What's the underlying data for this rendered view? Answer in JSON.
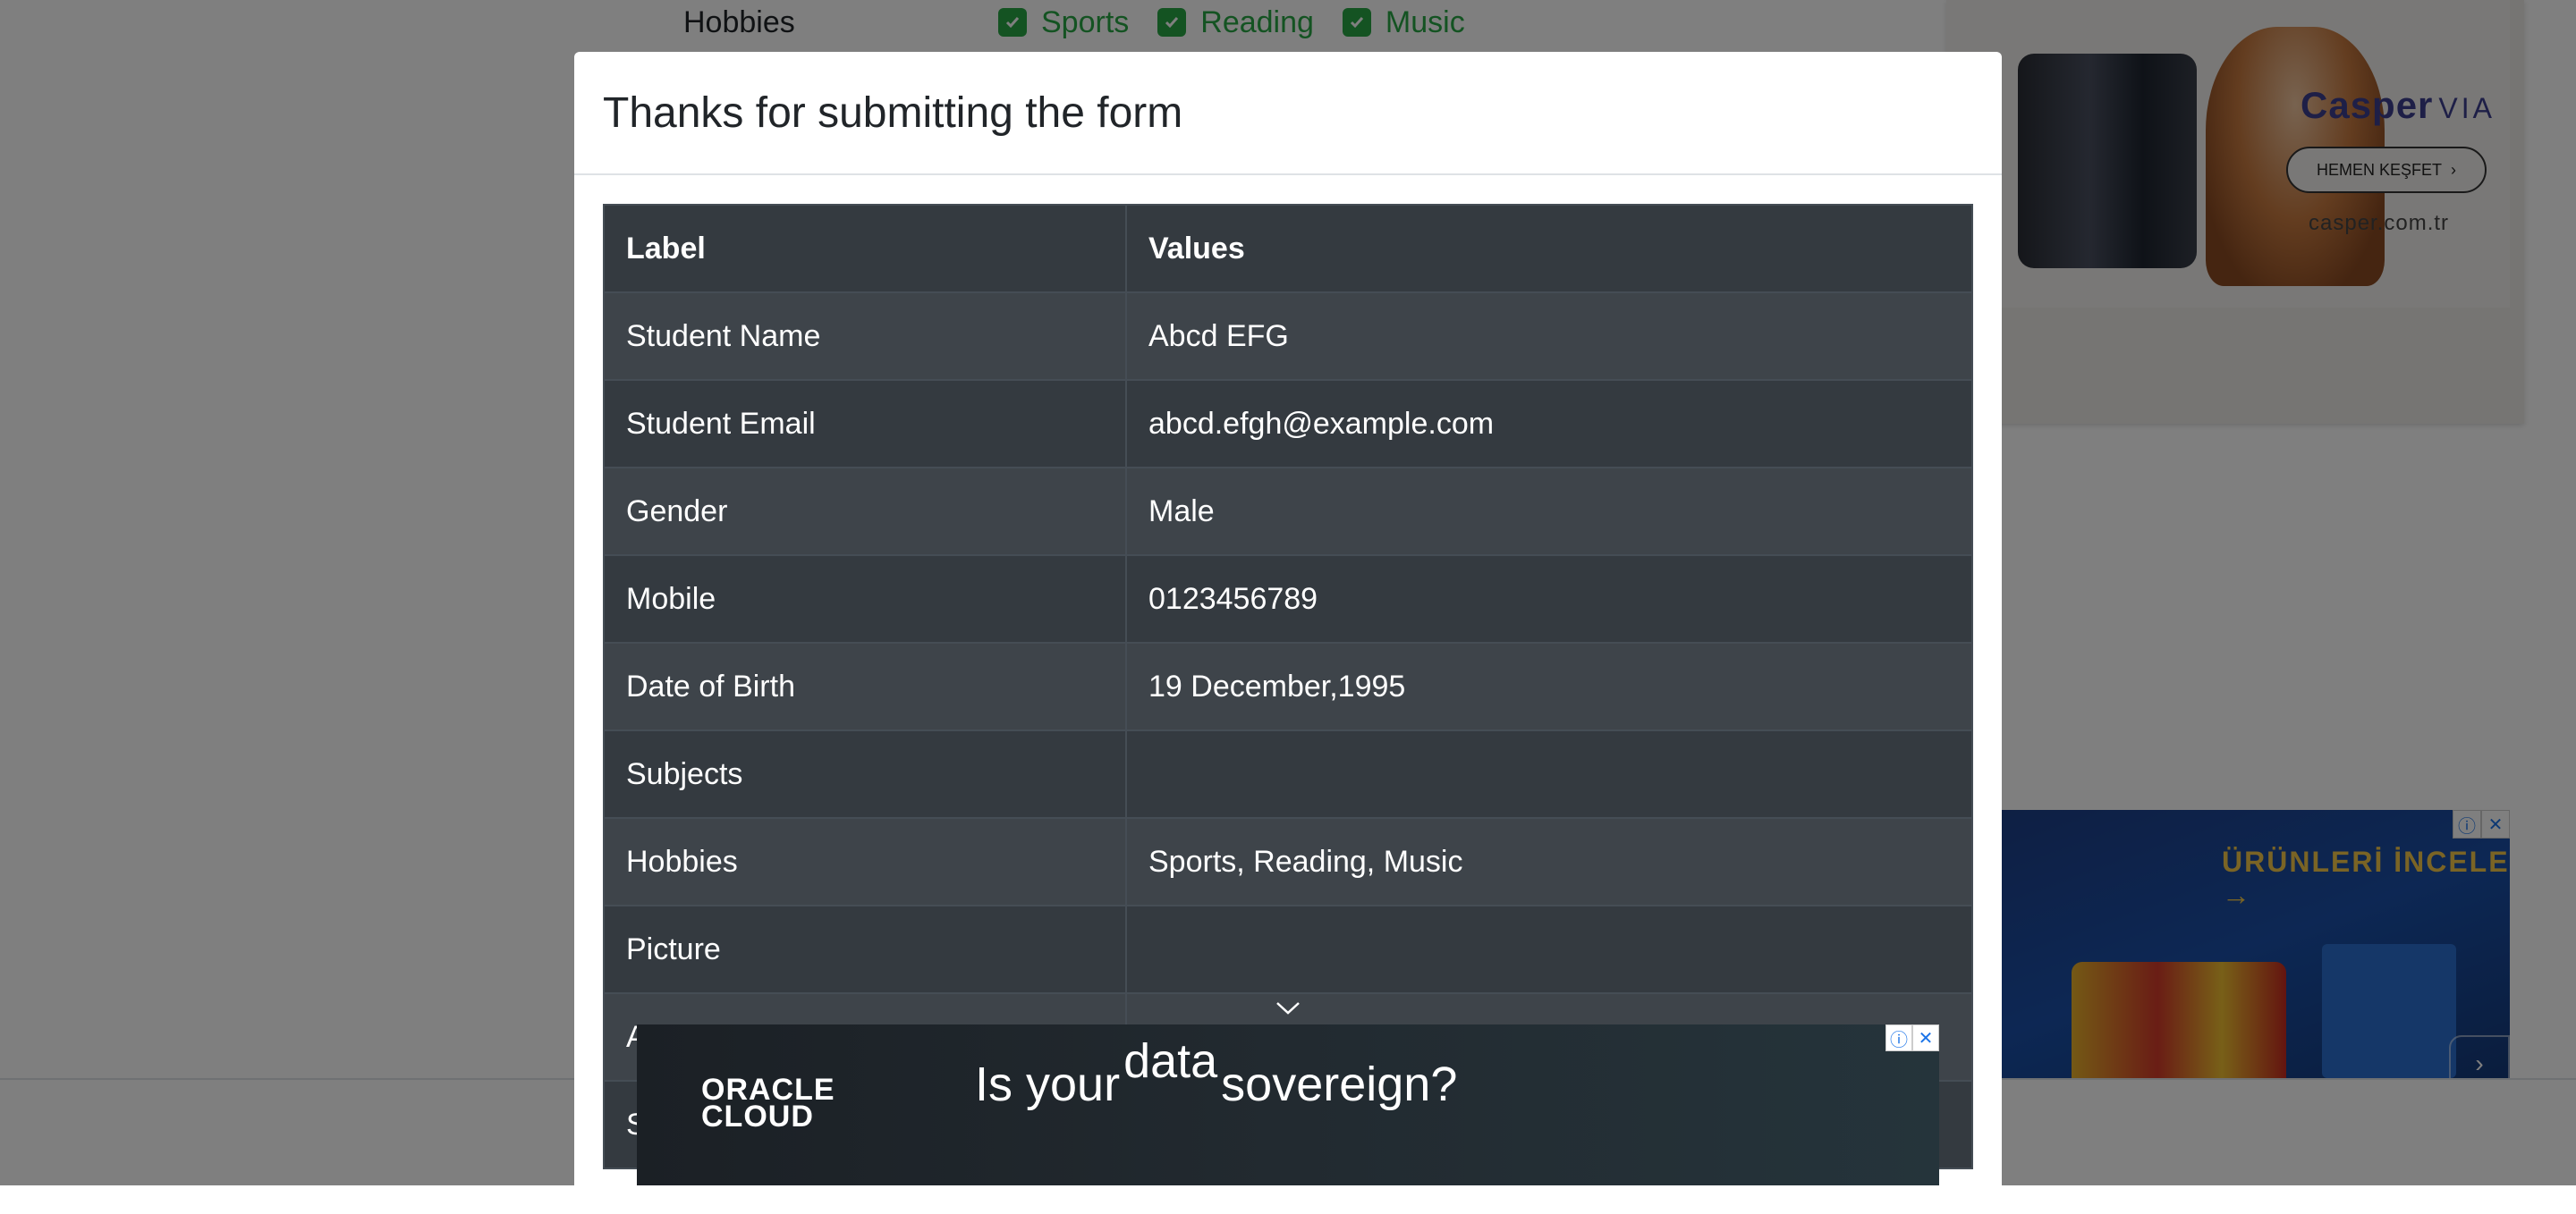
{
  "background": {
    "hobbies_label": "Hobbies",
    "hobbies": [
      "Sports",
      "Reading",
      "Music"
    ]
  },
  "ads": {
    "top_right": {
      "brand": "Casper",
      "brand_suffix": "VIA",
      "cta": "HEMEN KEŞFET",
      "domain": "casper.com.tr"
    },
    "middle_right": {
      "cta": "ÜRÜNLERİ İNCELE →"
    },
    "bottom": {
      "logo_line1": "ORACLE",
      "logo_line2": "CLOUD",
      "headline_pre": "Is your",
      "headline_sup": "data",
      "headline_post": "sovereign?"
    },
    "info_icon": "ⓘ",
    "close_icon": "✕"
  },
  "modal": {
    "title": "Thanks for submitting the form",
    "table": {
      "headers": [
        "Label",
        "Values"
      ],
      "rows": [
        {
          "label": "Student Name",
          "value": "Abcd EFG"
        },
        {
          "label": "Student Email",
          "value": "abcd.efgh@example.com"
        },
        {
          "label": "Gender",
          "value": "Male"
        },
        {
          "label": "Mobile",
          "value": "0123456789"
        },
        {
          "label": "Date of Birth",
          "value": "19 December,1995"
        },
        {
          "label": "Subjects",
          "value": ""
        },
        {
          "label": "Hobbies",
          "value": "Sports, Reading, Music"
        },
        {
          "label": "Picture",
          "value": ""
        },
        {
          "label": "A",
          "value": ""
        },
        {
          "label": "S",
          "value": ""
        }
      ]
    }
  },
  "colors": {
    "overlay": "rgba(0,0,0,0.5)",
    "table_dark": "#343a40",
    "table_striped": "#3e444a",
    "checkbox_green": "#28a745"
  }
}
